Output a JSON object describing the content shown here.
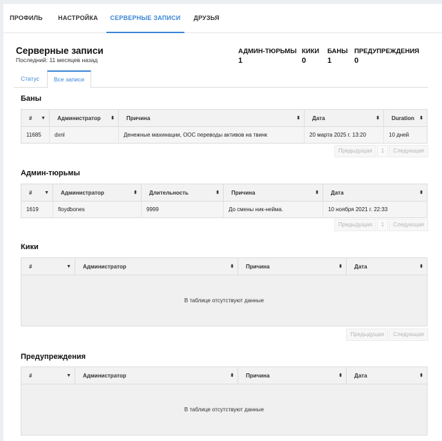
{
  "nav": {
    "tabs": [
      {
        "label": "ПРОФИЛЬ"
      },
      {
        "label": "НАСТРОЙКА"
      },
      {
        "label": "СЕРВЕРНЫЕ ЗАПИСИ"
      },
      {
        "label": "ДРУЗЬЯ"
      }
    ]
  },
  "header": {
    "title": "Серверные записи",
    "subtitle": "Последний: 11 месяцев назад",
    "stats": [
      {
        "label": "АДМИН-ТЮРЬМЫ",
        "value": "1"
      },
      {
        "label": "КИКИ",
        "value": "0"
      },
      {
        "label": "БАНЫ",
        "value": "1"
      },
      {
        "label": "ПРЕДУПРЕЖДЕНИЯ",
        "value": "0"
      }
    ]
  },
  "subtabs": [
    {
      "label": "Статус"
    },
    {
      "label": "Все записи"
    }
  ],
  "pager": {
    "prev": "Предыдущая",
    "next": "Следующая",
    "page": "1"
  },
  "empty_text": "В таблице отсутствуют данные",
  "bans": {
    "title": "Баны",
    "columns": [
      "#",
      "Администратор",
      "Причина",
      "Дата",
      "Duration"
    ],
    "rows": [
      [
        "11685",
        "dxnl",
        "Денежные махинации, ООС переводы активов на твинк",
        "20 марта 2025 г. 13:20",
        "10 дней"
      ]
    ]
  },
  "jails": {
    "title": "Админ-тюрьмы",
    "columns": [
      "#",
      "Администратор",
      "Длительность",
      "Причина",
      "Дата"
    ],
    "rows": [
      [
        "1619",
        "floydbones",
        "9999",
        "До смены ник-нейма.",
        "10 ноября 2021 г. 22:33"
      ]
    ]
  },
  "kicks": {
    "title": "Кики",
    "columns": [
      "#",
      "Администратор",
      "Причина",
      "Дата"
    ]
  },
  "warnings": {
    "title": "Предупреждения",
    "columns": [
      "#",
      "Администратор",
      "Причина",
      "Дата"
    ]
  }
}
